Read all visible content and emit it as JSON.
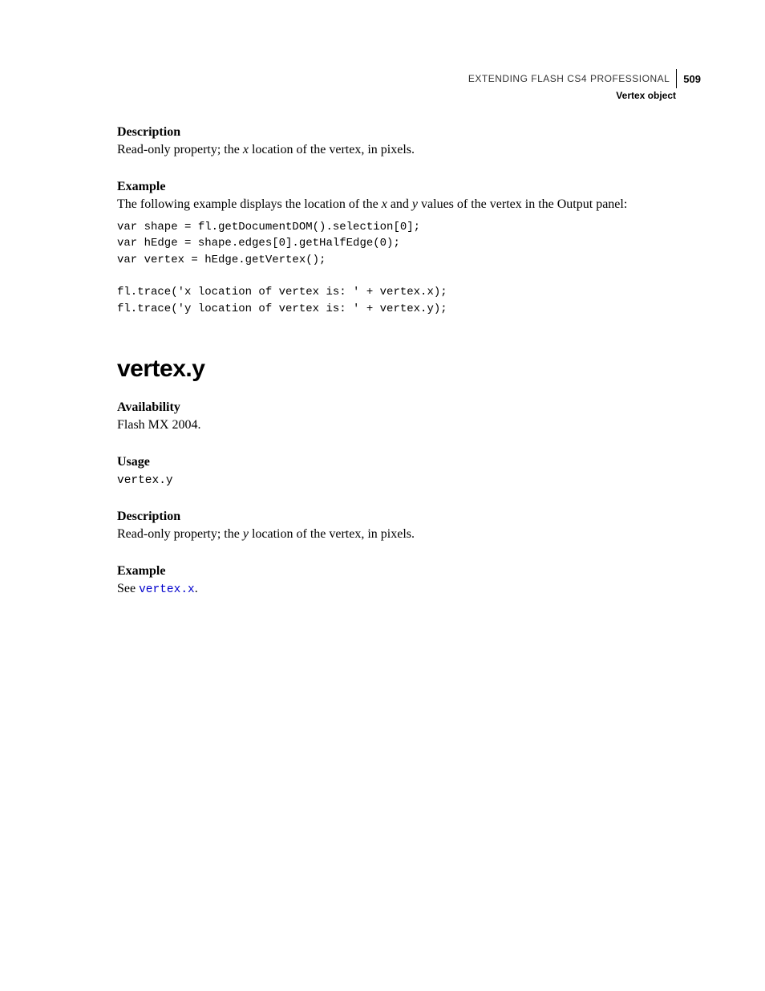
{
  "header": {
    "book_title": "EXTENDING FLASH CS4 PROFESSIONAL",
    "page_number": "509",
    "chapter": "Vertex object"
  },
  "section_x": {
    "desc_label": "Description",
    "desc_pre": "Read-only property; the ",
    "desc_var": "x",
    "desc_post": " location of the vertex, in pixels.",
    "example_label": "Example",
    "example_pre": "The following example displays the location of the ",
    "example_var1": "x",
    "example_mid": " and ",
    "example_var2": "y",
    "example_post": " values of the vertex in the Output panel:",
    "code": "var shape = fl.getDocumentDOM().selection[0];\nvar hEdge = shape.edges[0].getHalfEdge(0);\nvar vertex = hEdge.getVertex();\n\nfl.trace('x location of vertex is: ' + vertex.x);\nfl.trace('y location of vertex is: ' + vertex.y);"
  },
  "section_y": {
    "heading": "vertex.y",
    "avail_label": "Availability",
    "avail_text": "Flash MX 2004.",
    "usage_label": "Usage",
    "usage_code": "vertex.y",
    "desc_label": "Description",
    "desc_pre": "Read-only property; the ",
    "desc_var": "y",
    "desc_post": " location of the vertex, in pixels.",
    "example_label": "Example",
    "example_pre": "See ",
    "example_link": "vertex.x",
    "example_post": "."
  }
}
